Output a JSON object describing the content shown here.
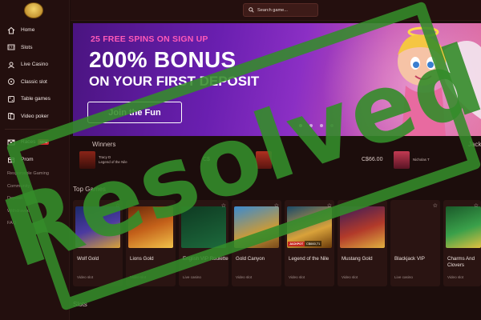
{
  "colors": {
    "accent": "#ff5ab8",
    "stamp": "#348c2a",
    "bg": "#1c0d0c",
    "sidebar": "#230f0e"
  },
  "sidebar": {
    "logo_icon": "casino-logo",
    "items": [
      {
        "label": "Home",
        "icon": "home-icon"
      },
      {
        "label": "Slots",
        "icon": "slot-icon"
      },
      {
        "label": "Live Casino",
        "icon": "live-icon"
      },
      {
        "label": "Classic slot",
        "icon": "classic-icon"
      },
      {
        "label": "Table games",
        "icon": "table-icon"
      },
      {
        "label": "Video poker",
        "icon": "poker-icon"
      }
    ],
    "races": {
      "label": "Races",
      "badge": "NEW"
    },
    "promos": {
      "label": "Prom"
    },
    "links": [
      "Responsible Gaming",
      "Community",
      "Deposit",
      "Withdrawal",
      "FAQ"
    ]
  },
  "topbar": {
    "search_placeholder": "Search game..."
  },
  "banner": {
    "subtitle": "25 FREE SPINS ON SIGN UP",
    "title": "200% BONUS",
    "title_line2": "ON YOUR FIRST DEPOSIT",
    "cta": "Join the Fun",
    "slide_count": 4,
    "active_slide": 1
  },
  "winners": {
    "title": "Winners",
    "right_title": "Jack",
    "cards": [
      {
        "name": "Tracy D",
        "detail": "Legend of the Nile",
        "amount": ""
      },
      {
        "name": "",
        "detail": "",
        "amount": "C$"
      },
      {
        "name": "",
        "detail": "",
        "amount": "C$66.00"
      },
      {
        "name": "Nicholas T",
        "detail": "",
        "amount": ""
      }
    ]
  },
  "top_games": {
    "title": "Top Games"
  },
  "games": [
    {
      "name": "Wolf Gold",
      "category": "Video slot"
    },
    {
      "name": "Lions Gold",
      "category": "Video slot"
    },
    {
      "name": "English VIP Roulette",
      "category": "Live casino"
    },
    {
      "name": "Gold Canyon",
      "category": "Video slot"
    },
    {
      "name": "Legend of the Nile",
      "category": "Video slot",
      "jackpot": "JACKPOT",
      "jackpot_amount": "C$660,71"
    },
    {
      "name": "Mustang Gold",
      "category": "Video slot"
    },
    {
      "name": "Blackjack VIP",
      "category": "Live casino"
    },
    {
      "name": "Charms And Clovers",
      "category": "Video slot"
    }
  ],
  "slots_section": {
    "title": "Slots"
  },
  "stamp": {
    "text": "Resolved"
  }
}
